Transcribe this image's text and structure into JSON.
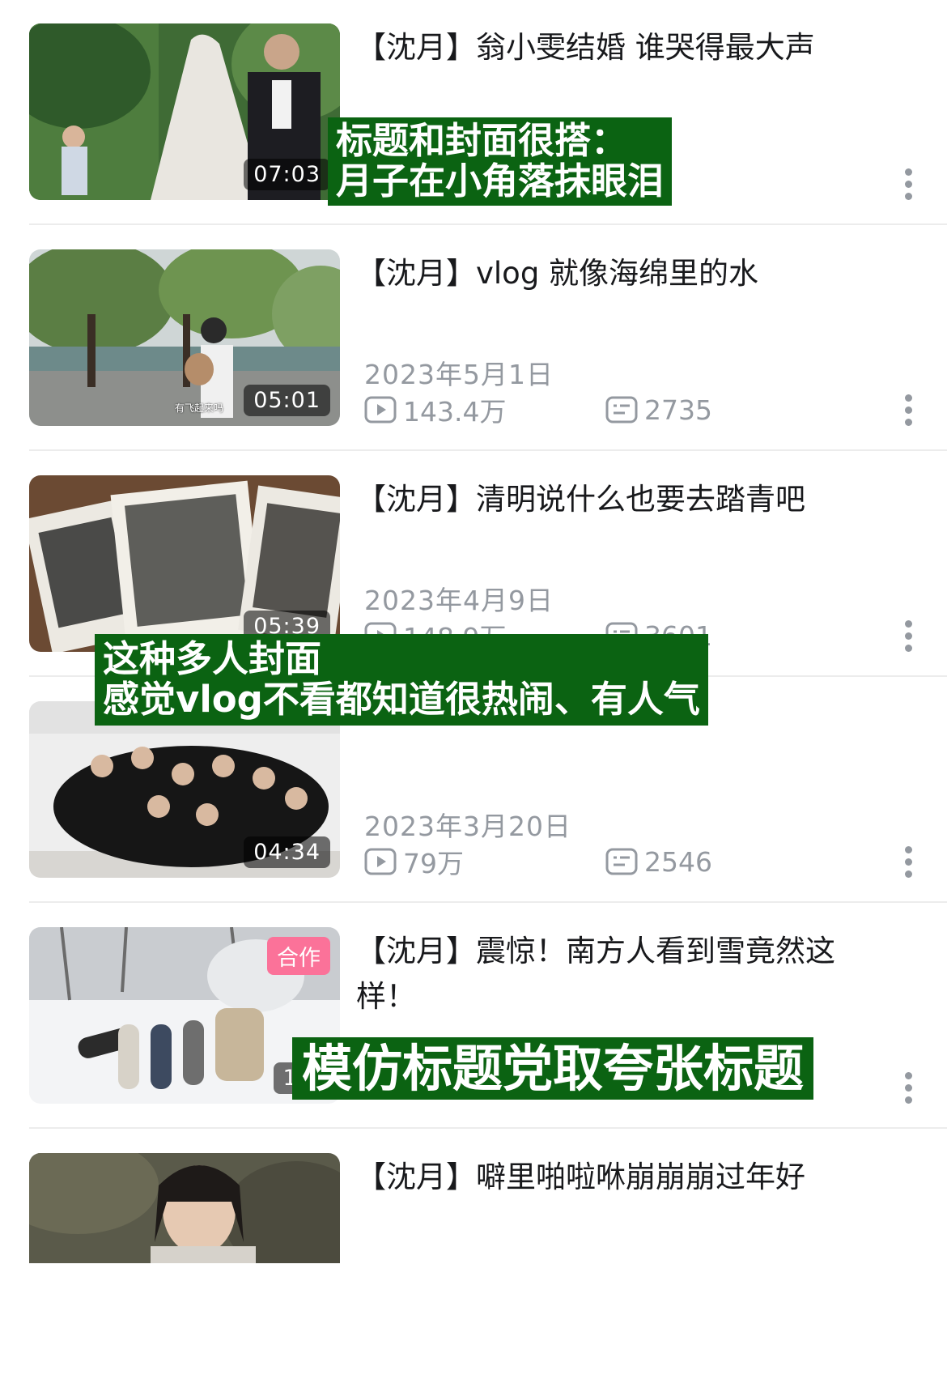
{
  "videos": [
    {
      "title": "【沈月】翁小雯结婚 谁哭得最大声",
      "date": "",
      "views": "",
      "comments": "",
      "duration": "07:03",
      "badge": ""
    },
    {
      "title": "【沈月】vlog 就像海绵里的水",
      "date": "2023年5月1日",
      "views": "143.4万",
      "comments": "2735",
      "duration": "05:01",
      "badge": "",
      "caption": "有飞起来吗"
    },
    {
      "title": "【沈月】清明说什么也要去踏青吧",
      "date": "2023年4月9日",
      "views": "148.9万",
      "comments": "3601",
      "duration": "05:39",
      "badge": ""
    },
    {
      "title": "",
      "date": "2023年3月20日",
      "views": "79万",
      "comments": "2546",
      "duration": "04:34",
      "badge": ""
    },
    {
      "title": "【沈月】震惊！南方人看到雪竟然这样！",
      "date": "",
      "views": "",
      "comments": "",
      "duration": "16:",
      "badge": "合作"
    },
    {
      "title": "【沈月】噼里啪啦咻崩崩崩过年好",
      "date": "",
      "views": "",
      "comments": "",
      "duration": "",
      "badge": ""
    }
  ],
  "annotations": {
    "a1": {
      "line1": "标题和封面很搭：",
      "line2": "月子在小角落抹眼泪"
    },
    "a2": {
      "line1": "这种多人封面",
      "line2": "感觉vlog不看都知道很热闹、有人气"
    },
    "a3": {
      "line1": "模仿标题党取夸张标题"
    }
  },
  "icons": {
    "play": "play-icon",
    "comment": "danmaku-icon",
    "more": "more-vertical-icon"
  },
  "colors": {
    "annotation_bg": "#0b6312",
    "badge": "#fb7299",
    "meta_text": "#9499a0"
  }
}
